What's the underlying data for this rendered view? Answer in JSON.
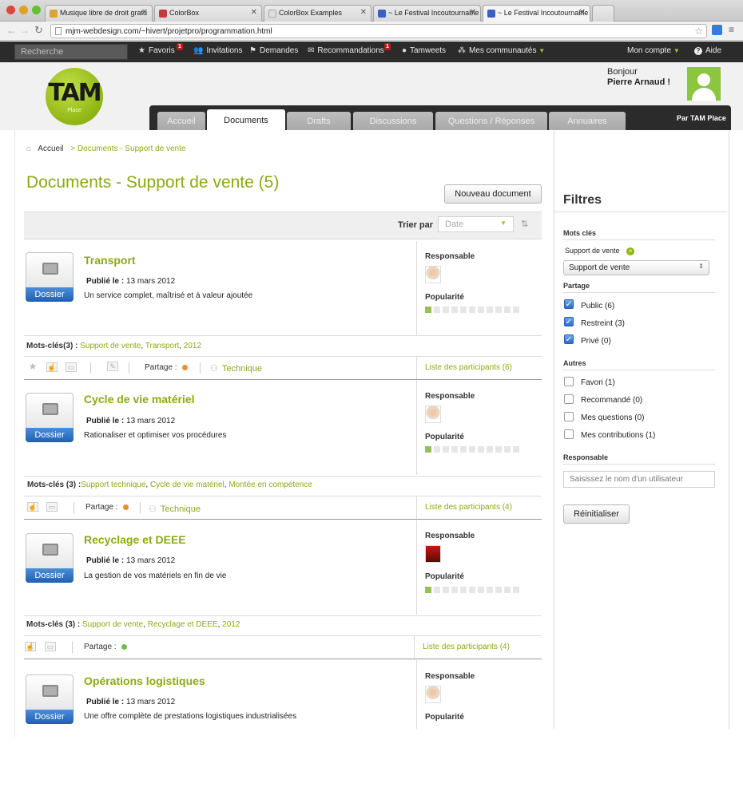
{
  "browser": {
    "tabs": [
      {
        "title": "Musique libre de droit gratu",
        "fav": "#d9a43a"
      },
      {
        "title": "ColorBox",
        "fav": "#c43a3a"
      },
      {
        "title": "ColorBox Examples",
        "fav": "#dddddd"
      },
      {
        "title": "~ Le Festival Incoutournable",
        "fav": "#3a5fc4"
      },
      {
        "title": "~ Le Festival Incoutournable",
        "fav": "#3a5fc4"
      }
    ],
    "url": "mjm-webdesign.com/~hivert/projetpro/programmation.html"
  },
  "topnav": {
    "search_placeholder": "Recherche",
    "items": [
      {
        "label": "Favoris",
        "icon": "star-icon",
        "badge": "1"
      },
      {
        "label": "Invitations",
        "icon": "people-icon"
      },
      {
        "label": "Demandes",
        "icon": "flag-icon"
      },
      {
        "label": "Recommandations",
        "icon": "envelope-icon",
        "badge": "1"
      },
      {
        "label": "Tamweets",
        "icon": "person-icon"
      },
      {
        "label": "Mes communautés",
        "icon": "community-icon"
      }
    ],
    "account": "Mon compte",
    "help": "Aide"
  },
  "header": {
    "logo_text": "TAM",
    "logo_sub": "Place",
    "greeting": "Bonjour",
    "user_name": "Pierre Arnaud !",
    "tabs": [
      "Accueil",
      "Documents",
      "Drafts",
      "Discussions",
      "Questions / Réponses",
      "Annuaires"
    ],
    "active_tab": "Documents",
    "by": "Par TAM Place"
  },
  "breadcrumb": {
    "home": "Accueil",
    "current": "> Documents - Support de vente"
  },
  "page_title": "Documents - Support de vente (5)",
  "new_doc_button": "Nouveau document",
  "sort": {
    "label": "Trier par",
    "value": "Date"
  },
  "documents": [
    {
      "title": "Transport",
      "published_label": "Publié le :",
      "published": "13 mars 2012",
      "description": "Un service complet, maîtrisé et à valeur ajoutée",
      "icon_label": "Dossier",
      "responsable_label": "Responsable",
      "popularite_label": "Popularité",
      "popularity": 1,
      "keywords_label": "Mots-clés(3) :",
      "keywords": [
        " Support de vente",
        ", ",
        "Transport",
        ", ",
        "2012"
      ],
      "partage_label": "Partage :",
      "partage_color": "#e8902a",
      "category": "Technique",
      "participants": "Liste des participants (6)"
    },
    {
      "title": "Cycle de vie matériel",
      "published_label": "Publié le :",
      "published": "13 mars 2012",
      "description": "Rationaliser et optimiser vos procédures",
      "icon_label": "Dossier",
      "responsable_label": "Responsable",
      "popularite_label": "Popularité",
      "popularity": 1,
      "keywords_label": "Mots-clés (3) :",
      "keywords": [
        "Support technique",
        ", ",
        "Cycle de vie matériel",
        ", ",
        "Montée en compétence"
      ],
      "partage_label": "Partage :",
      "partage_color": "#e8902a",
      "category": "Technique",
      "participants": "Liste des participants (4)"
    },
    {
      "title": "Recyclage et DEEE",
      "published_label": "Publié le :",
      "published": "13 mars 2012",
      "description": "La gestion de vos matériels en fin de vie",
      "icon_label": "Dossier",
      "responsable_label": "Responsable",
      "popularite_label": "Popularité",
      "popularity": 1,
      "keywords_label": "Mots-clés (3) :",
      "keywords": [
        " Support de vente",
        ", ",
        "Recyclage et DEEE",
        ", ",
        "2012"
      ],
      "partage_label": "Partage :",
      "partage_color": "#6fbf4a",
      "participants": "Liste des participants (4)"
    },
    {
      "title": "Opérations logistiques",
      "published_label": "Publié le :",
      "published": "13 mars 2012",
      "description": "Une offre complète de prestations logistiques industrialisées",
      "icon_label": "Dossier",
      "responsable_label": "Responsable",
      "popularite_label": "Popularité"
    }
  ],
  "sidebar": {
    "title": "Filtres",
    "keywords_head": "Mots clés",
    "active_keyword": "Support de vente",
    "keyword_select": "Support de vente",
    "partage_head": "Partage",
    "partage_options": [
      {
        "label": "Public (6)",
        "checked": true
      },
      {
        "label": "Restreint (3)",
        "checked": true
      },
      {
        "label": "Privé (0)",
        "checked": true
      }
    ],
    "autres_head": "Autres",
    "autres_options": [
      {
        "label": "Favori (1)",
        "checked": false
      },
      {
        "label": "Recommandé (0)",
        "checked": false
      },
      {
        "label": "Mes questions (0)",
        "checked": false
      },
      {
        "label": "Mes contributions (1)",
        "checked": false
      }
    ],
    "responsable_head": "Responsable",
    "responsable_placeholder": "Saisissez le nom d'un utilisateur",
    "reset_button": "Réinitialiser"
  },
  "colors": {
    "accent": "#8aaa15",
    "topbar": "#2b2b2b"
  }
}
